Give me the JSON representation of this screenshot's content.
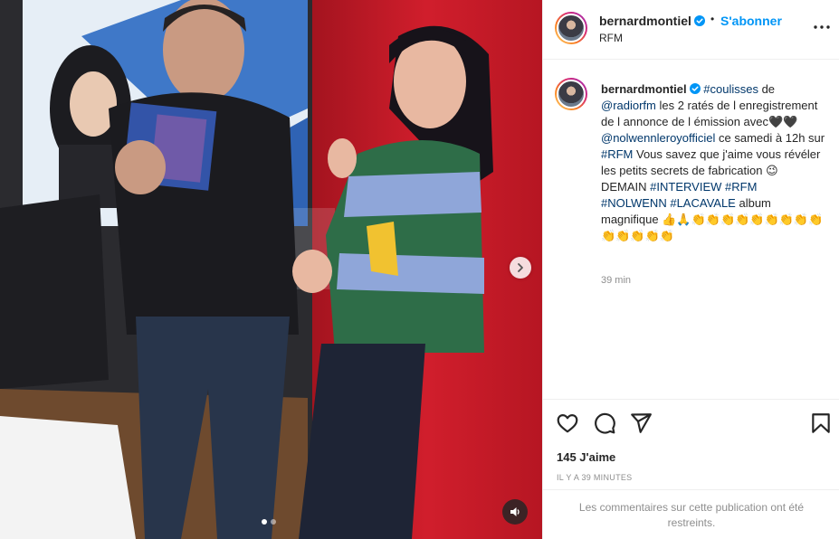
{
  "post": {
    "username": "bernardmontiel",
    "separator": "•",
    "follow_label": "S'abonner",
    "location": "RFM"
  },
  "caption": {
    "username": "bernardmontiel",
    "segments": [
      {
        "type": "tag",
        "text": "#coulisses"
      },
      {
        "type": "text",
        "text": " de "
      },
      {
        "type": "tag",
        "text": "@radiorfm"
      },
      {
        "type": "text",
        "text": " les 2 ratés de l enregistrement de l annonce de l émission avec🖤🖤 "
      },
      {
        "type": "tag",
        "text": "@nolwennleroyofficiel"
      },
      {
        "type": "text",
        "text": " ce samedi à 12h sur "
      },
      {
        "type": "tag",
        "text": "#RFM"
      },
      {
        "type": "text",
        "text": " Vous savez que j'aime vous révéler les petits secrets de fabrication 😉 DEMAIN "
      },
      {
        "type": "tag",
        "text": "#INTERVIEW"
      },
      {
        "type": "text",
        "text": " "
      },
      {
        "type": "tag",
        "text": "#RFM"
      },
      {
        "type": "text",
        "text": " "
      },
      {
        "type": "tag",
        "text": "#NOLWENN"
      },
      {
        "type": "text",
        "text": " "
      },
      {
        "type": "tag",
        "text": "#LACAVALE"
      },
      {
        "type": "text",
        "text": " album magnifique 👍🙏👏👏👏👏👏👏👏👏👏👏👏👏👏👏"
      }
    ],
    "time": "39 min"
  },
  "media": {
    "carousel_dots": 2,
    "active_dot": 0
  },
  "stats": {
    "likes": "145 J'aime",
    "timestamp": "IL Y A 39 MINUTES"
  },
  "comments": {
    "restricted_note": "Les commentaires sur cette publication ont été restreints."
  },
  "icons": {
    "verified": "verified-badge-icon",
    "more": "more-options-icon",
    "like": "heart-icon",
    "comment": "comment-icon",
    "share": "share-icon",
    "save": "bookmark-icon",
    "next": "chevron-right-icon",
    "sound": "speaker-icon"
  },
  "colors": {
    "accent": "#0095f6",
    "tag": "#00376b",
    "muted": "#8e8e8e",
    "verified": "#0095f6"
  }
}
